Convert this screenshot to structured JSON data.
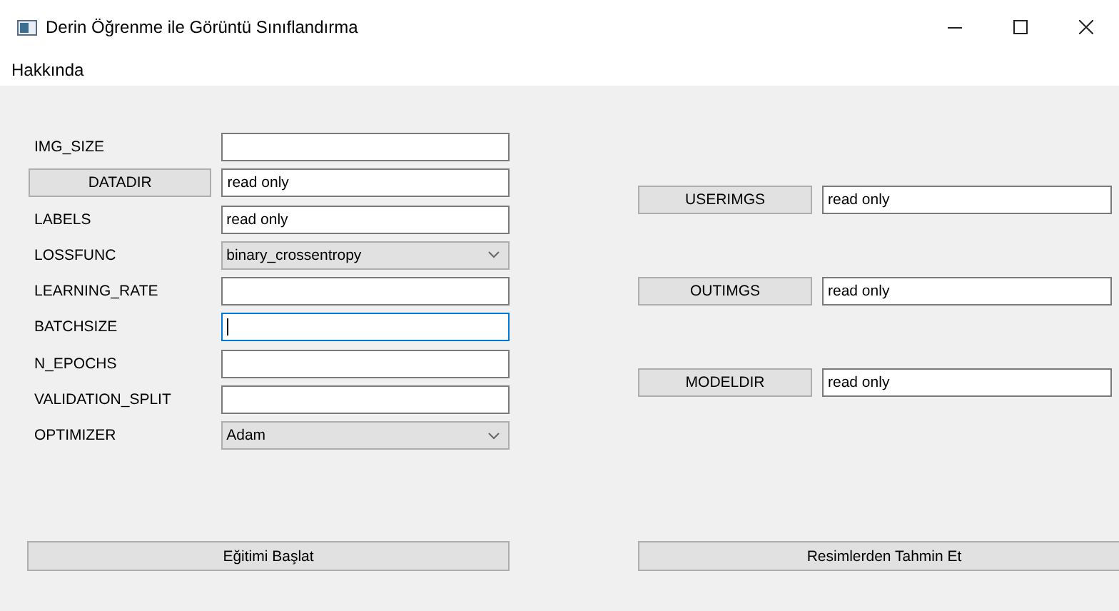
{
  "window": {
    "title": "Derin Öğrenme ile Görüntü Sınıflandırma"
  },
  "menu": [
    {
      "label": "Hakkında"
    }
  ],
  "training_form": {
    "rows": [
      {
        "kind": "field",
        "label": "IMG_SIZE",
        "focused": false
      },
      {
        "kind": "button",
        "label": "DATADIR",
        "value": "read only",
        "focused": false
      },
      {
        "kind": "field",
        "label": "LABELS",
        "value": "read only",
        "focused": false
      },
      {
        "kind": "dropdown",
        "label": "LOSSFUNC",
        "value": "binary_crossentropy"
      },
      {
        "kind": "field",
        "label": "LEARNING_RATE",
        "focused": false
      },
      {
        "kind": "field",
        "label": "BATCHSIZE",
        "focused": true
      },
      {
        "kind": "field",
        "label": "N_EPOCHS",
        "focused": false
      },
      {
        "kind": "field",
        "label": "VALIDATION_SPLIT",
        "focused": false
      },
      {
        "kind": "dropdown",
        "label": "OPTIMIZER",
        "value": "Adam"
      }
    ],
    "action": "Eğitimi Başlat"
  },
  "prediction_form": {
    "rows": [
      {
        "button": "USERIMGS",
        "value": "read only"
      },
      {
        "button": "OUTIMGS",
        "value": "read only"
      },
      {
        "button": "MODELDIR",
        "value": "read only"
      }
    ],
    "action": "Resimlerden Tahmin Et"
  }
}
